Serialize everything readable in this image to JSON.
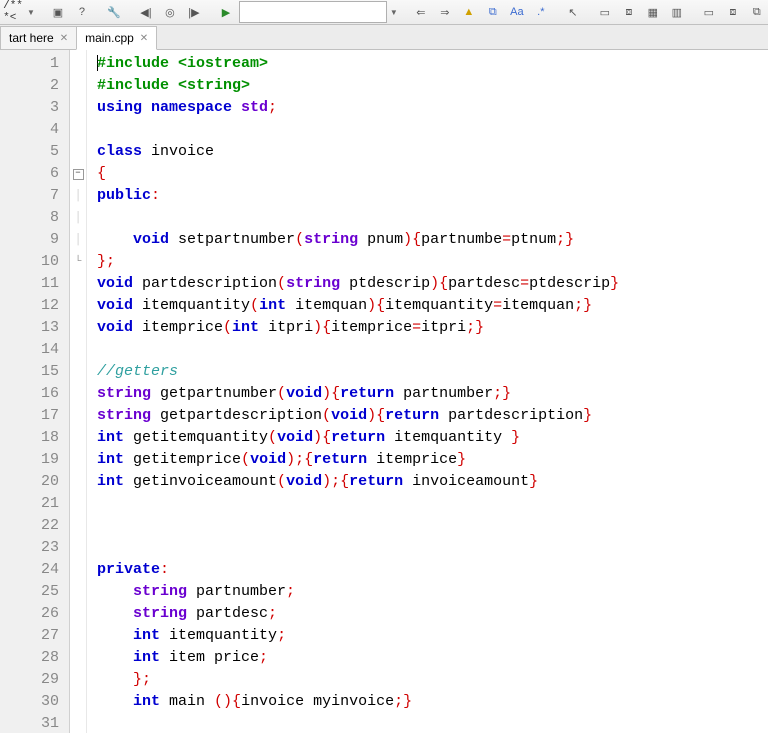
{
  "toolbar": {
    "doxy_label": "/** *<",
    "combo_value": ""
  },
  "tabs": [
    {
      "label": "tart here",
      "active": false
    },
    {
      "label": "main.cpp",
      "active": true
    }
  ],
  "gutter": {
    "start": 1,
    "end": 31
  },
  "code_lines": [
    {
      "n": 1,
      "indent": "",
      "tokens": [
        {
          "t": "#include ",
          "c": "pp"
        },
        {
          "t": "<iostream>",
          "c": "pp"
        }
      ]
    },
    {
      "n": 2,
      "indent": "",
      "tokens": [
        {
          "t": "#include ",
          "c": "pp"
        },
        {
          "t": "<string>",
          "c": "pp"
        }
      ]
    },
    {
      "n": 3,
      "indent": "",
      "tokens": [
        {
          "t": "using ",
          "c": "kw"
        },
        {
          "t": "namespace ",
          "c": "kw"
        },
        {
          "t": "std",
          "c": "kw2"
        },
        {
          "t": ";",
          "c": "punc"
        }
      ]
    },
    {
      "n": 4,
      "indent": "",
      "tokens": []
    },
    {
      "n": 5,
      "indent": "",
      "tokens": [
        {
          "t": "class ",
          "c": "kw"
        },
        {
          "t": "invoice",
          "c": "id"
        }
      ]
    },
    {
      "n": 6,
      "indent": "",
      "tokens": [
        {
          "t": "{",
          "c": "punc"
        }
      ],
      "fold": "minus"
    },
    {
      "n": 7,
      "indent": "",
      "tokens": [
        {
          "t": "public",
          "c": "kw"
        },
        {
          "t": ":",
          "c": "punc"
        }
      ]
    },
    {
      "n": 8,
      "indent": "",
      "tokens": []
    },
    {
      "n": 9,
      "indent": "    ",
      "tokens": [
        {
          "t": "void ",
          "c": "kw"
        },
        {
          "t": "setpartnumber",
          "c": "id"
        },
        {
          "t": "(",
          "c": "punc"
        },
        {
          "t": "string ",
          "c": "kw2"
        },
        {
          "t": "pnum",
          "c": "id"
        },
        {
          "t": "){",
          "c": "punc"
        },
        {
          "t": "partnumbe",
          "c": "id"
        },
        {
          "t": "=",
          "c": "punc"
        },
        {
          "t": "ptnum",
          "c": "id"
        },
        {
          "t": ";}",
          "c": "punc"
        }
      ]
    },
    {
      "n": 10,
      "indent": "",
      "tokens": [
        {
          "t": "};",
          "c": "punc"
        }
      ],
      "fold": "end"
    },
    {
      "n": 11,
      "indent": "",
      "tokens": [
        {
          "t": "void ",
          "c": "kw"
        },
        {
          "t": "partdescription",
          "c": "id"
        },
        {
          "t": "(",
          "c": "punc"
        },
        {
          "t": "string ",
          "c": "kw2"
        },
        {
          "t": "ptdescrip",
          "c": "id"
        },
        {
          "t": "){",
          "c": "punc"
        },
        {
          "t": "partdesc",
          "c": "id"
        },
        {
          "t": "=",
          "c": "punc"
        },
        {
          "t": "ptdescrip",
          "c": "id"
        },
        {
          "t": "}",
          "c": "punc"
        }
      ]
    },
    {
      "n": 12,
      "indent": "",
      "tokens": [
        {
          "t": "void ",
          "c": "kw"
        },
        {
          "t": "itemquantity",
          "c": "id"
        },
        {
          "t": "(",
          "c": "punc"
        },
        {
          "t": "int ",
          "c": "kw"
        },
        {
          "t": "itemquan",
          "c": "id"
        },
        {
          "t": "){",
          "c": "punc"
        },
        {
          "t": "itemquantity",
          "c": "id"
        },
        {
          "t": "=",
          "c": "punc"
        },
        {
          "t": "itemquan",
          "c": "id"
        },
        {
          "t": ";}",
          "c": "punc"
        }
      ]
    },
    {
      "n": 13,
      "indent": "",
      "tokens": [
        {
          "t": "void ",
          "c": "kw"
        },
        {
          "t": "itemprice",
          "c": "id"
        },
        {
          "t": "(",
          "c": "punc"
        },
        {
          "t": "int ",
          "c": "kw"
        },
        {
          "t": "itpri",
          "c": "id"
        },
        {
          "t": "){",
          "c": "punc"
        },
        {
          "t": "itemprice",
          "c": "id"
        },
        {
          "t": "=",
          "c": "punc"
        },
        {
          "t": "itpri",
          "c": "id"
        },
        {
          "t": ";}",
          "c": "punc"
        }
      ]
    },
    {
      "n": 14,
      "indent": "",
      "tokens": []
    },
    {
      "n": 15,
      "indent": "",
      "tokens": [
        {
          "t": "//getters",
          "c": "cmt"
        }
      ]
    },
    {
      "n": 16,
      "indent": "",
      "tokens": [
        {
          "t": "string ",
          "c": "kw2"
        },
        {
          "t": "getpartnumber",
          "c": "id"
        },
        {
          "t": "(",
          "c": "punc"
        },
        {
          "t": "void",
          "c": "kw"
        },
        {
          "t": "){",
          "c": "punc"
        },
        {
          "t": "return ",
          "c": "kw"
        },
        {
          "t": "partnumber",
          "c": "id"
        },
        {
          "t": ";}",
          "c": "punc"
        }
      ]
    },
    {
      "n": 17,
      "indent": "",
      "tokens": [
        {
          "t": "string ",
          "c": "kw2"
        },
        {
          "t": "getpartdescription",
          "c": "id"
        },
        {
          "t": "(",
          "c": "punc"
        },
        {
          "t": "void",
          "c": "kw"
        },
        {
          "t": "){",
          "c": "punc"
        },
        {
          "t": "return ",
          "c": "kw"
        },
        {
          "t": "partdescription",
          "c": "id"
        },
        {
          "t": "}",
          "c": "punc"
        }
      ]
    },
    {
      "n": 18,
      "indent": "",
      "tokens": [
        {
          "t": "int ",
          "c": "kw"
        },
        {
          "t": "getitemquantity",
          "c": "id"
        },
        {
          "t": "(",
          "c": "punc"
        },
        {
          "t": "void",
          "c": "kw"
        },
        {
          "t": "){",
          "c": "punc"
        },
        {
          "t": "return ",
          "c": "kw"
        },
        {
          "t": "itemquantity ",
          "c": "id"
        },
        {
          "t": "}",
          "c": "punc"
        }
      ]
    },
    {
      "n": 19,
      "indent": "",
      "tokens": [
        {
          "t": "int ",
          "c": "kw"
        },
        {
          "t": "getitemprice",
          "c": "id"
        },
        {
          "t": "(",
          "c": "punc"
        },
        {
          "t": "void",
          "c": "kw"
        },
        {
          "t": ");{",
          "c": "punc"
        },
        {
          "t": "return ",
          "c": "kw"
        },
        {
          "t": "itemprice",
          "c": "id"
        },
        {
          "t": "}",
          "c": "punc"
        }
      ]
    },
    {
      "n": 20,
      "indent": "",
      "tokens": [
        {
          "t": "int ",
          "c": "kw"
        },
        {
          "t": "getinvoiceamount",
          "c": "id"
        },
        {
          "t": "(",
          "c": "punc"
        },
        {
          "t": "void",
          "c": "kw"
        },
        {
          "t": ");{",
          "c": "punc"
        },
        {
          "t": "return ",
          "c": "kw"
        },
        {
          "t": "invoiceamount",
          "c": "id"
        },
        {
          "t": "}",
          "c": "punc"
        }
      ]
    },
    {
      "n": 21,
      "indent": "",
      "tokens": []
    },
    {
      "n": 22,
      "indent": "",
      "tokens": []
    },
    {
      "n": 23,
      "indent": "",
      "tokens": []
    },
    {
      "n": 24,
      "indent": "",
      "tokens": [
        {
          "t": "private",
          "c": "kw"
        },
        {
          "t": ":",
          "c": "punc"
        }
      ]
    },
    {
      "n": 25,
      "indent": "    ",
      "tokens": [
        {
          "t": "string ",
          "c": "kw2"
        },
        {
          "t": "partnumber",
          "c": "id"
        },
        {
          "t": ";",
          "c": "punc"
        }
      ]
    },
    {
      "n": 26,
      "indent": "    ",
      "tokens": [
        {
          "t": "string ",
          "c": "kw2"
        },
        {
          "t": "partdesc",
          "c": "id"
        },
        {
          "t": ";",
          "c": "punc"
        }
      ]
    },
    {
      "n": 27,
      "indent": "    ",
      "tokens": [
        {
          "t": "int ",
          "c": "kw"
        },
        {
          "t": "itemquantity",
          "c": "id"
        },
        {
          "t": ";",
          "c": "punc"
        }
      ]
    },
    {
      "n": 28,
      "indent": "    ",
      "tokens": [
        {
          "t": "int ",
          "c": "kw"
        },
        {
          "t": "item price",
          "c": "id"
        },
        {
          "t": ";",
          "c": "punc"
        }
      ]
    },
    {
      "n": 29,
      "indent": "    ",
      "tokens": [
        {
          "t": "};",
          "c": "punc"
        }
      ]
    },
    {
      "n": 30,
      "indent": "    ",
      "tokens": [
        {
          "t": "int ",
          "c": "kw"
        },
        {
          "t": "main ",
          "c": "id"
        },
        {
          "t": "(){",
          "c": "punc"
        },
        {
          "t": "invoice myinvoice",
          "c": "id"
        },
        {
          "t": ";}",
          "c": "punc"
        }
      ]
    },
    {
      "n": 31,
      "indent": "",
      "tokens": []
    }
  ]
}
